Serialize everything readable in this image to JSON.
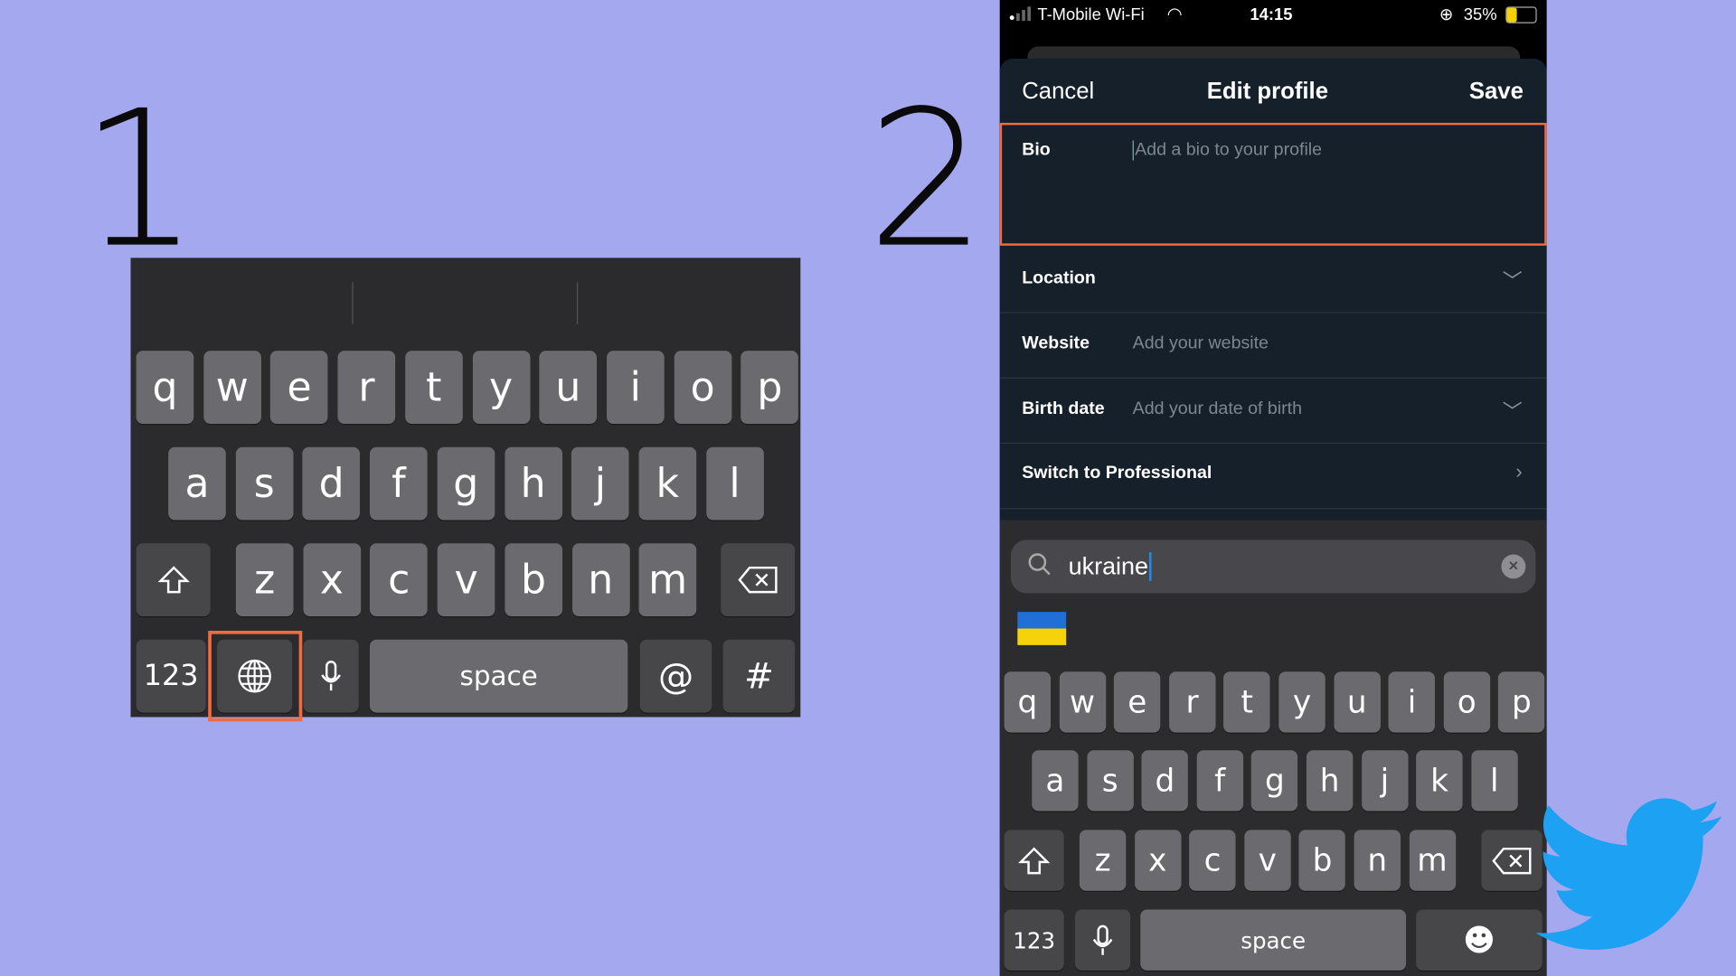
{
  "labels": {
    "step1": "1",
    "step2": "2"
  },
  "keyboard1": {
    "rows": [
      [
        "q",
        "w",
        "e",
        "r",
        "t",
        "y",
        "u",
        "i",
        "o",
        "p"
      ],
      [
        "a",
        "s",
        "d",
        "f",
        "g",
        "h",
        "j",
        "k",
        "l"
      ],
      [
        "z",
        "x",
        "c",
        "v",
        "b",
        "n",
        "m"
      ]
    ],
    "numbers_key": "123",
    "space_key": "space",
    "at_key": "@",
    "hash_key": "#",
    "highlight_color": "#f26a3d",
    "highlighted_key": "globe"
  },
  "phone": {
    "status": {
      "carrier": "T-Mobile Wi-Fi",
      "time": "14:15",
      "battery": "35%"
    },
    "header": {
      "cancel": "Cancel",
      "title": "Edit profile",
      "save": "Save"
    },
    "bio": {
      "label": "Bio",
      "placeholder": "Add a bio to your profile"
    },
    "location": {
      "label": "Location"
    },
    "website": {
      "label": "Website",
      "placeholder": "Add your website"
    },
    "birth_date": {
      "label": "Birth date",
      "placeholder": "Add your date of birth"
    },
    "professional": {
      "label": "Switch to Professional"
    },
    "emoji_search": {
      "value": "ukraine",
      "result": "🇺🇦"
    },
    "keyboard": {
      "rows": [
        [
          "q",
          "w",
          "e",
          "r",
          "t",
          "y",
          "u",
          "i",
          "o",
          "p"
        ],
        [
          "a",
          "s",
          "d",
          "f",
          "g",
          "h",
          "j",
          "k",
          "l"
        ],
        [
          "z",
          "x",
          "c",
          "v",
          "b",
          "n",
          "m"
        ]
      ],
      "numbers_key": "123",
      "space_key": "space"
    }
  },
  "colors": {
    "background": "#a3a8ef",
    "highlight": "#f26a3d",
    "twitter": "#1da1f2",
    "sheet": "#15202b"
  }
}
